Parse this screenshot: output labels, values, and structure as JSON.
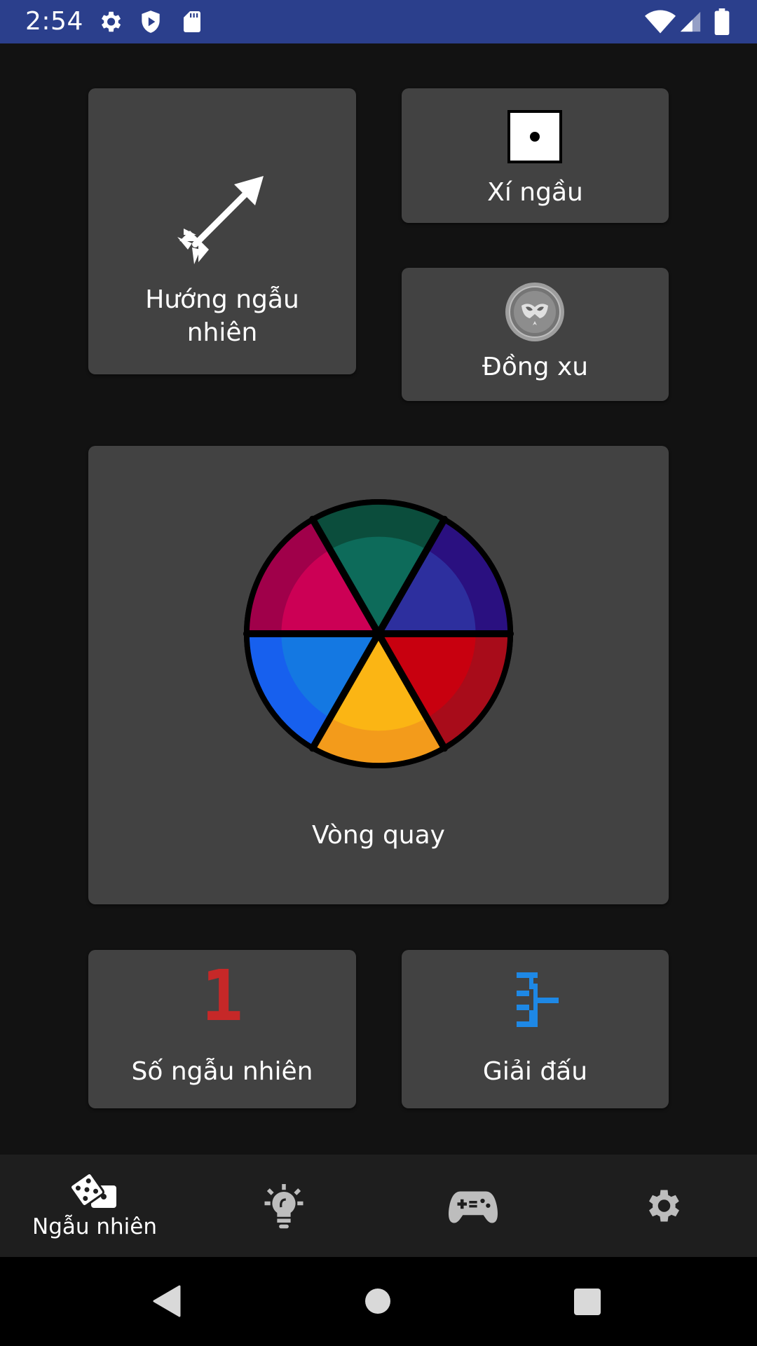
{
  "status_bar": {
    "time": "2:54",
    "bg_color": "#2b3f8c",
    "left_icons": [
      "gear-icon",
      "shield-play-icon",
      "sd-card-icon"
    ],
    "right_icons": [
      "wifi-icon",
      "cell-signal-icon",
      "battery-icon"
    ]
  },
  "tiles": {
    "random_direction": {
      "label": "Hướng ngẫu nhiên",
      "icon": "arrow-icon"
    },
    "dice": {
      "label": "Xí ngầu",
      "icon": "dice-icon"
    },
    "coin": {
      "label": "Đồng xu",
      "icon": "coin-icon"
    },
    "wheel": {
      "label": "Vòng quay",
      "icon": "wheel-icon",
      "segment_colors": [
        "#0d6b5a",
        "#2d2f9e",
        "#c8000f",
        "#fbb514",
        "#1478e2",
        "#cc0055"
      ]
    },
    "random_number": {
      "label": "Số ngẫu nhiên",
      "icon": "number-one-icon",
      "icon_glyph": "1",
      "icon_color": "#c62828"
    },
    "tournament": {
      "label": "Giải đấu",
      "icon": "bracket-icon",
      "icon_color": "#1e88e5"
    }
  },
  "bottom_nav": {
    "items": [
      {
        "label": "Ngẫu nhiên",
        "icon": "dice-pair-icon",
        "active": true
      },
      {
        "label": "",
        "icon": "lightbulb-icon",
        "active": false
      },
      {
        "label": "",
        "icon": "gamepad-icon",
        "active": false
      },
      {
        "label": "",
        "icon": "settings-gear-icon",
        "active": false
      }
    ]
  },
  "system_nav": {
    "buttons": [
      "back-icon",
      "home-icon",
      "recents-icon"
    ]
  },
  "colors": {
    "background": "#121212",
    "tile": "#424242",
    "bottom_nav": "#1e1e1e"
  }
}
